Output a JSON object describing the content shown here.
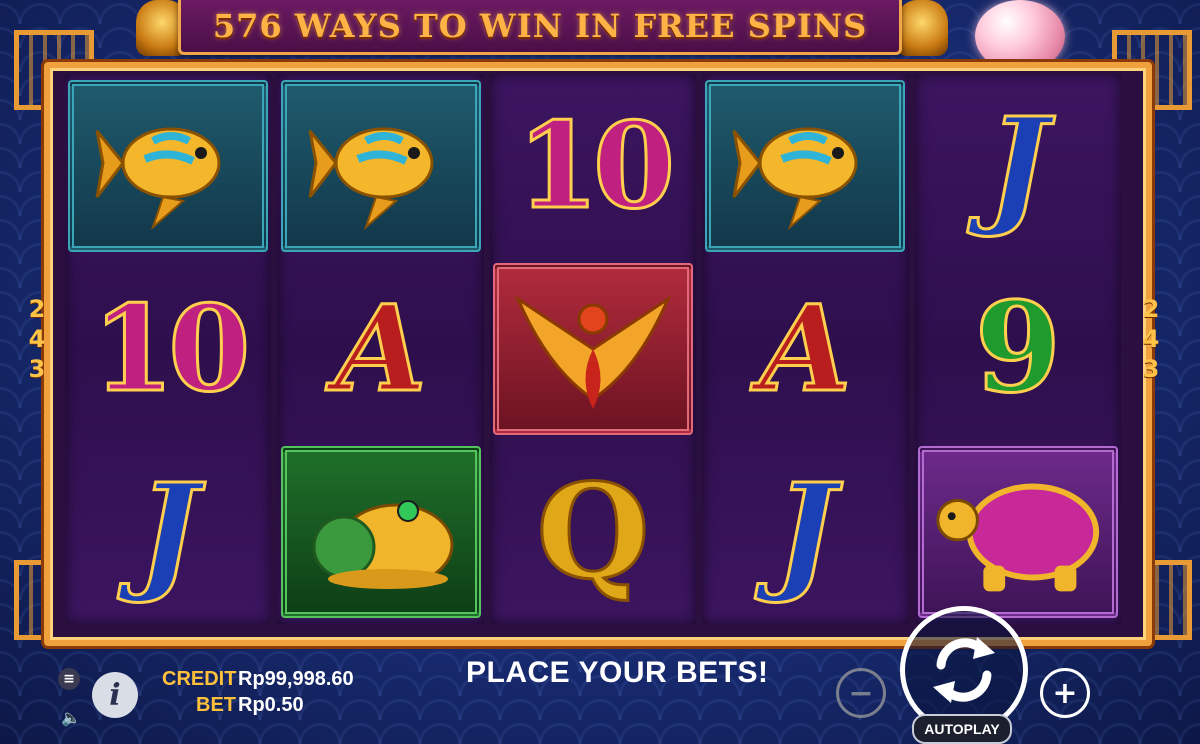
{
  "banner": {
    "title": "576 WAYS TO WIN IN FREE SPINS"
  },
  "ways_left": [
    "2",
    "4",
    "3"
  ],
  "ways_right": [
    "2",
    "4",
    "3"
  ],
  "reels": [
    [
      {
        "symbol": "koi-fish",
        "tile": "teal"
      },
      {
        "symbol": "10"
      },
      {
        "symbol": "J"
      }
    ],
    [
      {
        "symbol": "koi-fish",
        "tile": "teal"
      },
      {
        "symbol": "A"
      },
      {
        "symbol": "golden-toad",
        "tile": "green"
      }
    ],
    [
      {
        "symbol": "10"
      },
      {
        "symbol": "phoenix",
        "tile": "red"
      },
      {
        "symbol": "Q"
      }
    ],
    [
      {
        "symbol": "koi-fish",
        "tile": "teal"
      },
      {
        "symbol": "A"
      },
      {
        "symbol": "J"
      }
    ],
    [
      {
        "symbol": "J"
      },
      {
        "symbol": "9"
      },
      {
        "symbol": "turtle",
        "tile": "violet"
      }
    ]
  ],
  "hud": {
    "credit_label": "CREDIT",
    "credit_value": "Rp99,998.60",
    "bet_label": "BET",
    "bet_value": "Rp0.50",
    "status": "PLACE YOUR BETS!",
    "autoplay_label": "AUTOPLAY",
    "menu_icon": "menu-icon",
    "info_icon": "info-icon",
    "sound_icon": "speaker-icon",
    "minus_glyph": "−",
    "plus_glyph": "+"
  }
}
